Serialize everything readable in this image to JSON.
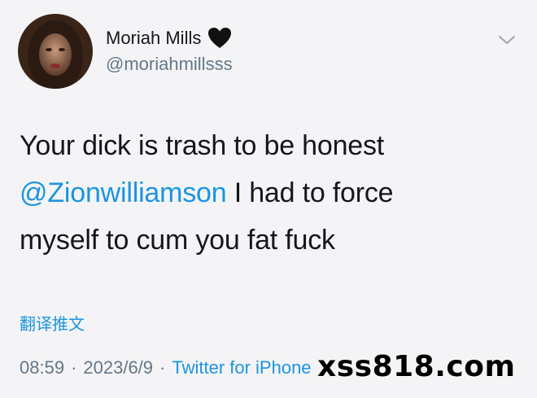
{
  "user": {
    "display_name": "Moriah Mills",
    "handle": "@moriahmillsss",
    "avatar_icon": "avatar-photo",
    "badge_icon": "black-heart-icon"
  },
  "tweet": {
    "line_1": "Your dick is trash to be honest",
    "mention": "@Zionwilliamson",
    "line_2_rest": " I had to force",
    "line_3": "myself to cum you fat fuck"
  },
  "translate_label": "翻译推文",
  "meta": {
    "time": "08:59",
    "separator": "·",
    "date": "2023/6/9",
    "source": "Twitter for iPhone"
  },
  "watermark": "xss818.com",
  "colors": {
    "background": "#f4f4f6",
    "text": "#14171a",
    "secondary": "#657786",
    "link": "#1b95e0"
  }
}
